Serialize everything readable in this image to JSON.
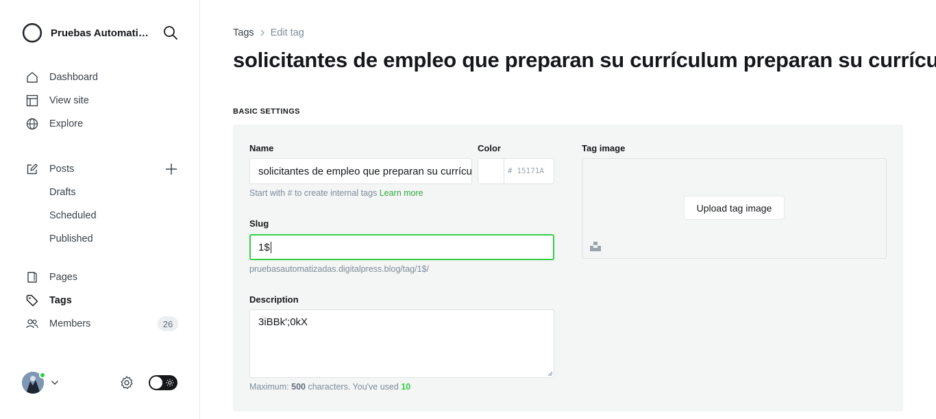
{
  "sidebar": {
    "site_name": "Pruebas Automatizadas",
    "nav": [
      {
        "label": "Dashboard",
        "icon": "home-icon"
      },
      {
        "label": "View site",
        "icon": "layout-icon"
      },
      {
        "label": "Explore",
        "icon": "globe-icon"
      }
    ],
    "posts": {
      "label": "Posts",
      "sub": [
        "Drafts",
        "Scheduled",
        "Published"
      ]
    },
    "pages_label": "Pages",
    "tags_label": "Tags",
    "members_label": "Members",
    "members_count": "26"
  },
  "breadcrumb": {
    "parent": "Tags",
    "current": "Edit tag"
  },
  "page_title": "solicitantes de empleo que preparan su currículum preparan su currículum",
  "section_label": "BASIC SETTINGS",
  "form": {
    "name_label": "Name",
    "name_value": "solicitantes de empleo que preparan su currículum",
    "name_hint": "Start with # to create internal tags",
    "name_hint_link": "Learn more",
    "color_label": "Color",
    "color_hex_placeholder": "# 15171A",
    "slug_label": "Slug",
    "slug_value": "1$",
    "slug_url": "pruebasautomatizadas.digitalpress.blog/tag/1$/",
    "description_label": "Description",
    "description_value": "3iBBk';0kX",
    "desc_hint_prefix": "Maximum:",
    "desc_max": "500",
    "desc_hint_middle": "characters. You've used",
    "desc_used": "10",
    "tag_image_label": "Tag image",
    "upload_label": "Upload tag image"
  },
  "colors": {
    "accent": "#30cf43",
    "panel_bg": "#f4f5f5",
    "text": "#15171a"
  }
}
